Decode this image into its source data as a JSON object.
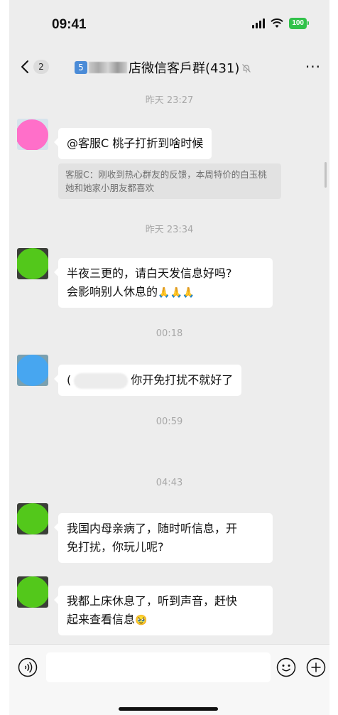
{
  "status_bar": {
    "time": "09:41",
    "battery": "100"
  },
  "nav": {
    "back_count": "2",
    "title_prefix": "5",
    "title": "店微信客戶群(431)",
    "more": "···"
  },
  "messages": [
    {
      "timestamp": "昨天 23:27"
    },
    {
      "text": "@客服C 桃子打折到啥时候",
      "quote": "客服C：刚收到热心群友的反馈，本周特价的白玉桃她和她家小朋友都喜欢"
    },
    {
      "timestamp": "昨天 23:34"
    },
    {
      "line1": "半夜三更的，请白天发信息好吗?",
      "line2": "会影响别人休息的"
    },
    {
      "prefix": "(",
      "text": "你开免打扰不就好了"
    },
    {
      "timestamp": "00:18"
    },
    {
      "timestamp": "00:59"
    },
    {
      "timestamp": "04:43"
    },
    {
      "line1": "我国内母亲病了，随时听信息，开",
      "line2": "免打扰，你玩儿呢?"
    },
    {
      "line1": "我都上床休息了，听到声音，赶快",
      "line2": "起来查看信息"
    }
  ],
  "colors": {
    "chat_background": "#ededed",
    "bubble": "#ffffff",
    "avatar_pink": "#ff6fc9",
    "avatar_green": "#53c81b",
    "avatar_blue": "#47a6f0",
    "battery": "#31c24a"
  },
  "icons": [
    "back-chevron-icon",
    "mute-bell-icon",
    "more-icon",
    "voice-icon",
    "emoji-icon",
    "add-icon",
    "folded-hands-emoji",
    "smile-emoji"
  ]
}
